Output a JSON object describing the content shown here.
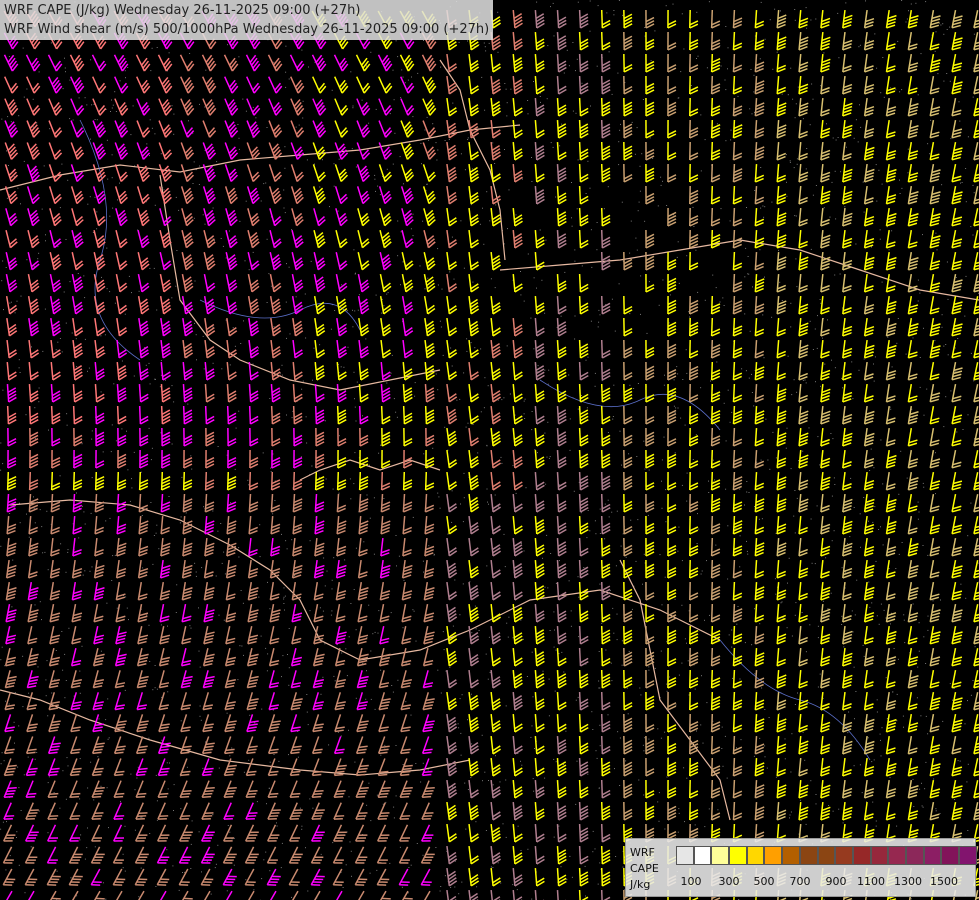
{
  "titles": {
    "line1": "WRF CAPE (J/kg) Wednesday 26-11-2025 09:00 (+27h)",
    "line2": "WRF Wind shear (m/s) 500/1000hPa Wednesday 26-11-2025 09:00 (+27h)"
  },
  "legend": {
    "labels": [
      "WRF",
      "CAPE",
      "J/kg"
    ],
    "ticks": [
      "100",
      "300",
      "500",
      "700",
      "900",
      "1100",
      "1300",
      "1500"
    ],
    "colors": [
      "#e6e6e6",
      "#ffffff",
      "#ffff99",
      "#ffff00",
      "#ffd700",
      "#ff9f00",
      "#b35f00",
      "#8b4513",
      "#8b4513",
      "#963a1f",
      "#962828",
      "#96283c",
      "#962850",
      "#8c285a",
      "#8c1e64",
      "#82145a",
      "#82146e"
    ]
  },
  "map_layers": {
    "background": "#000000",
    "wind_barb_palette": [
      "#ff00ff",
      "#ff7777",
      "#e07f6f",
      "#c98a6f",
      "#c9a070",
      "#ffff00",
      "#d8c070",
      "#b07f8f"
    ],
    "borders_color": "#e6b8a0",
    "rivers_color": "#5a6ec8"
  }
}
